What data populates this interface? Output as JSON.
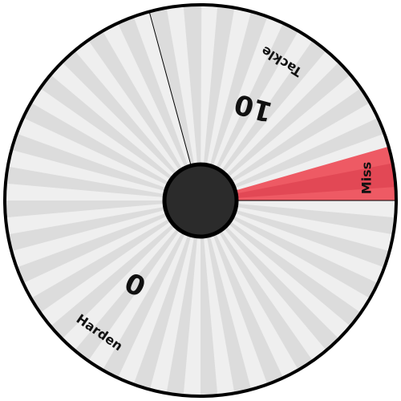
{
  "wheel": {
    "colors": {
      "stripe_light": "#efefef",
      "stripe_dark": "#dcdcdc",
      "miss_fill": "#ee5a64",
      "miss_inner": "#d93a48",
      "rim": "#000000",
      "hub": "#2b2b2b"
    },
    "segments": [
      {
        "name": "Tackle",
        "value": "10"
      },
      {
        "name": "Harden",
        "value": "0"
      }
    ],
    "miss": {
      "label": "Miss"
    }
  }
}
